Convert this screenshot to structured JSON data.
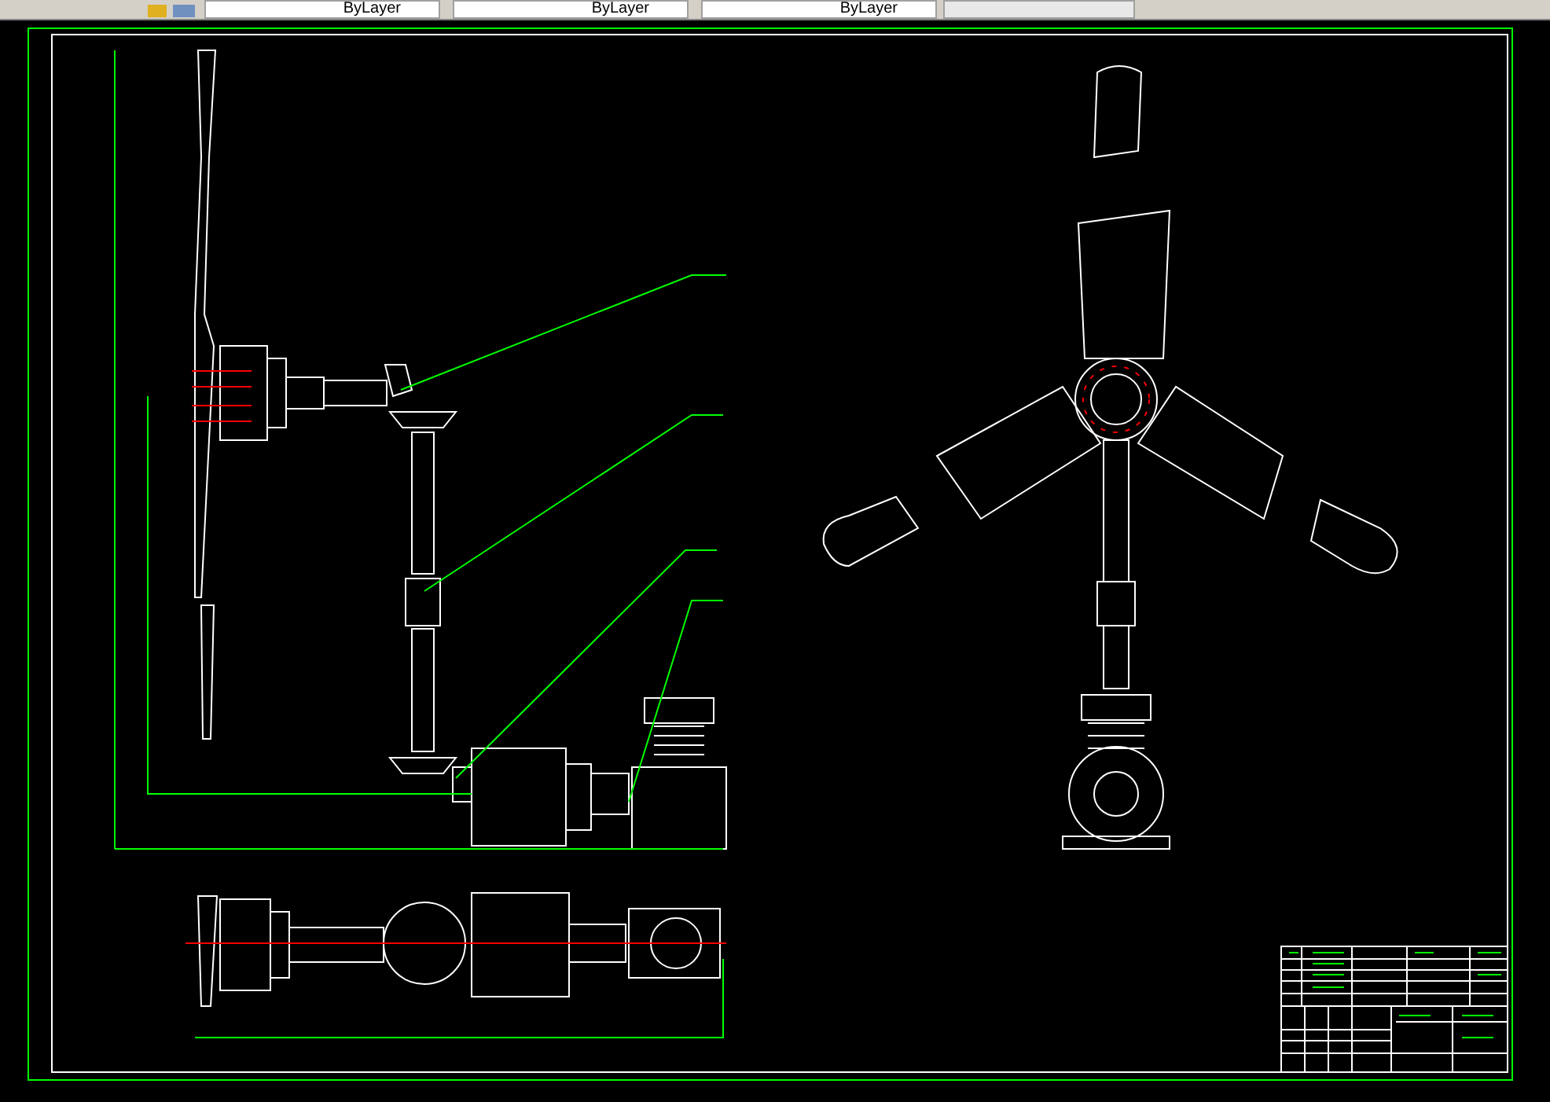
{
  "toolbar": {
    "dropdowns": [
      {
        "value": "ByLayer"
      },
      {
        "value": "ByLayer"
      },
      {
        "value": "ByLayer"
      }
    ]
  }
}
